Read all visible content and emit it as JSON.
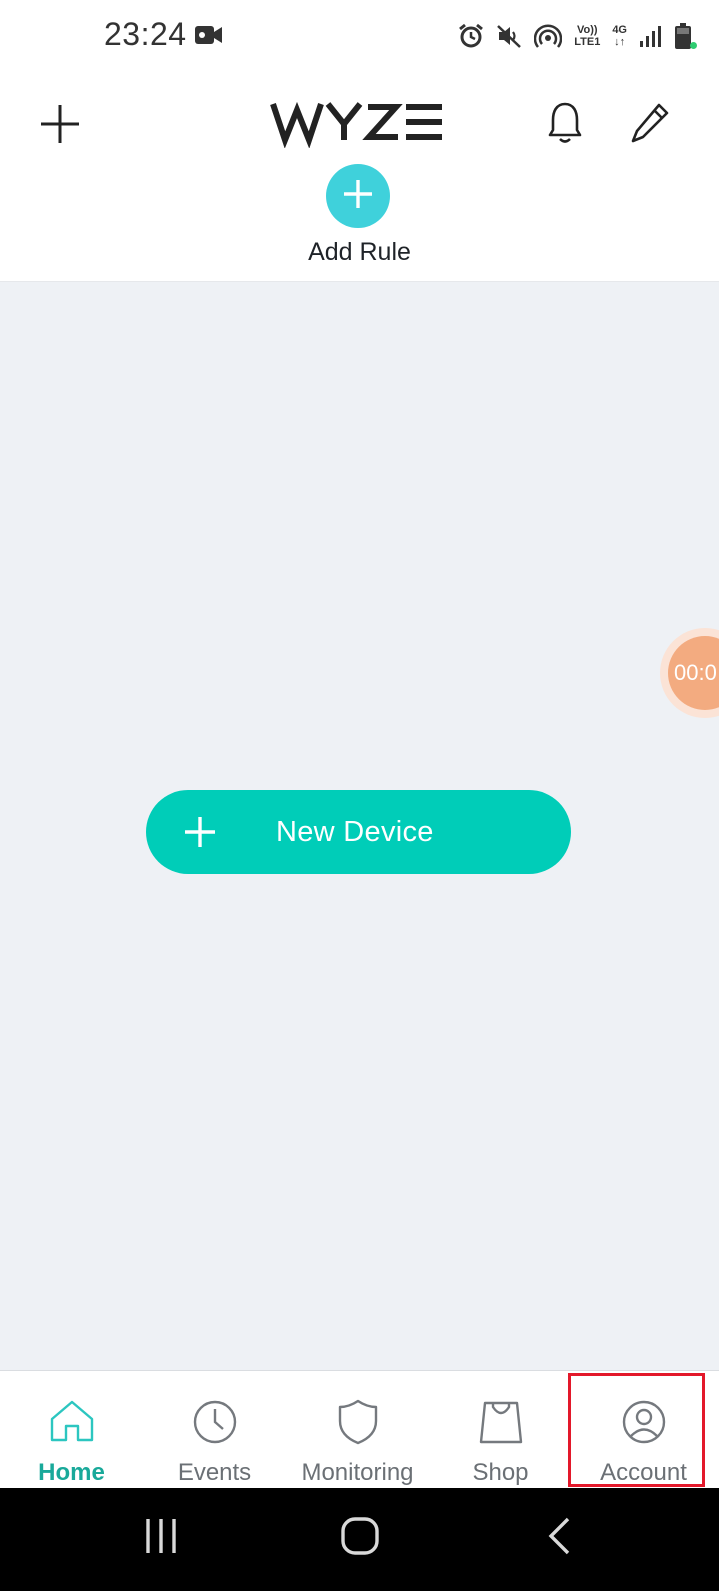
{
  "status_bar": {
    "time": "23:24",
    "network_label_top": "Vo))",
    "network_label_bottom": "LTE1",
    "data_label_top": "4G",
    "data_label_bottom": "↓↑"
  },
  "header": {
    "logo_text": "WYZE",
    "add_rule_label": "Add Rule"
  },
  "main": {
    "new_device_label": "New Device",
    "timer_text": "00:0"
  },
  "tabs": [
    {
      "label": "Home",
      "icon": "home-icon",
      "active": true
    },
    {
      "label": "Events",
      "icon": "clock-icon",
      "active": false
    },
    {
      "label": "Monitoring",
      "icon": "shield-icon",
      "active": false
    },
    {
      "label": "Shop",
      "icon": "shopping-bag-icon",
      "active": false
    },
    {
      "label": "Account",
      "icon": "account-icon",
      "active": false
    }
  ],
  "colors": {
    "accent_teal": "#00cdb8",
    "rule_button": "#3fd1db",
    "active_tab": "#19a99a",
    "highlight_outline": "#e3182a",
    "background": "#eef1f5"
  }
}
